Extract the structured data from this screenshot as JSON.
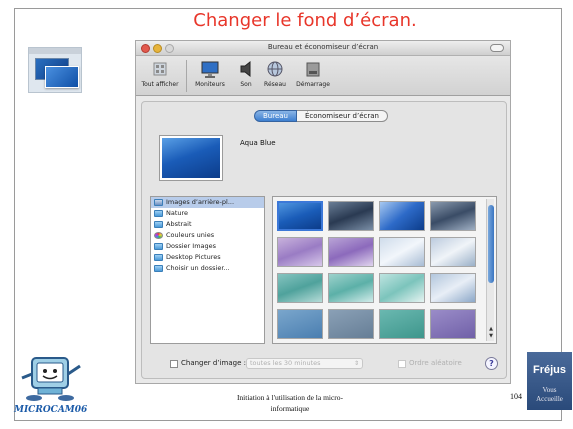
{
  "slide": {
    "title": "Changer le fond d’écran.",
    "footer_line1": "Initiation à l'utilisation de la micro-",
    "footer_line2": "informatique",
    "page_number": "104",
    "mascot_label": "MICROCAM06",
    "logo_top": "Fréjus",
    "logo_bottom_1": "Vous",
    "logo_bottom_2": "Accueille"
  },
  "window": {
    "title": "Bureau et économiseur d’écran",
    "toolbar": [
      {
        "label": "Tout afficher",
        "icon": "grid-icon"
      },
      {
        "label": "Moniteurs",
        "icon": "monitor-icon"
      },
      {
        "label": "Son",
        "icon": "speaker-icon"
      },
      {
        "label": "Réseau",
        "icon": "globe-icon"
      },
      {
        "label": "Démarrage",
        "icon": "disk-icon"
      }
    ],
    "tabs": {
      "active": "Bureau",
      "inactive": "Économiseur d’écran"
    },
    "preview_name": "Aqua Blue",
    "sources": [
      {
        "label": "Images d’arrière-pl...",
        "selected": true,
        "icon": "apple-icon"
      },
      {
        "label": "Nature",
        "selected": false,
        "icon": "folder-icon"
      },
      {
        "label": "Abstrait",
        "selected": false,
        "icon": "folder-icon"
      },
      {
        "label": "Couleurs unies",
        "selected": false,
        "icon": "color-wheel-icon"
      },
      {
        "label": "Dossier Images",
        "selected": false,
        "icon": "folder-icon"
      },
      {
        "label": "Desktop Pictures",
        "selected": false,
        "icon": "folder-icon"
      },
      {
        "label": "Choisir un dossier...",
        "selected": false,
        "icon": "folder-icon"
      }
    ],
    "change_image_label": "Changer d’image :",
    "interval_value": "toutes les 30 minutes",
    "random_label": "Ordre aléatoire",
    "help_label": "?"
  },
  "colors": {
    "title_red": "#e8362a",
    "selection": "#b8ccea",
    "aqua_blue": "#1a5cb8"
  }
}
